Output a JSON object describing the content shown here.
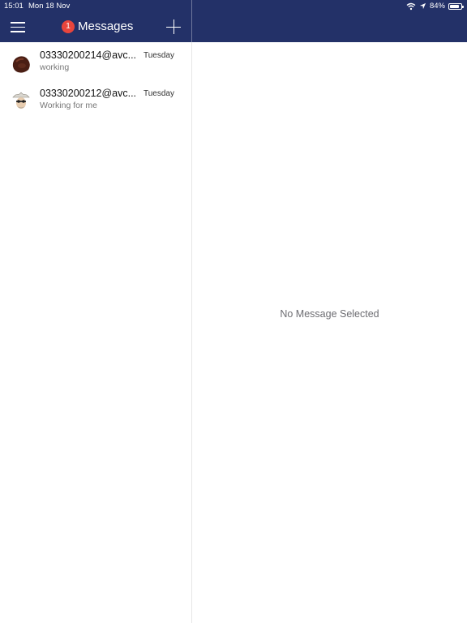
{
  "status": {
    "time": "15:01",
    "date": "Mon 18 Nov",
    "battery_percent_label": "84%",
    "battery_level": 0.84
  },
  "header": {
    "title": "Messages",
    "unread_badge": "1"
  },
  "conversations": [
    {
      "name": "03330200214@avc...",
      "date": "Tuesday",
      "preview": "working",
      "avatar_icon": "dark-rock-avatar"
    },
    {
      "name": "03330200212@avc...",
      "date": "Tuesday",
      "preview": "Working for me",
      "avatar_icon": "cowboy-face-avatar"
    }
  ],
  "detail": {
    "empty_text": "No Message Selected"
  },
  "colors": {
    "header_bg": "#233168",
    "badge": "#e8453c"
  }
}
